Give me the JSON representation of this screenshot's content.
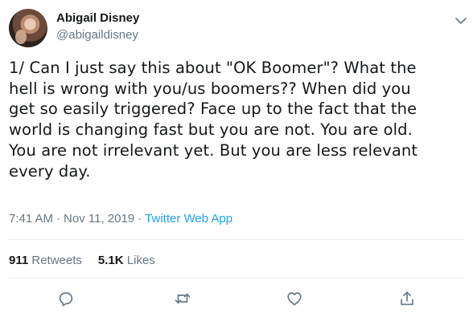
{
  "author": {
    "name": "Abigail Disney",
    "handle": "@abigaildisney",
    "avatar_icon": "user-avatar"
  },
  "tweet": {
    "text": "1/ Can I just say this about \"OK Boomer\"?  What the\nhell is wrong with you/us boomers??  When did you\nget so easily triggered?  Face up to the fact that the\nworld is changing fast but you are not.  You are old.\nYou are not irrelevant yet.  But you are less relevant\nevery day."
  },
  "meta": {
    "time": "7:41 AM",
    "separator": "·",
    "date": "Nov 11, 2019",
    "source": "Twitter Web App"
  },
  "stats": {
    "retweets_count": "911",
    "retweets_label": "Retweets",
    "likes_count": "5.1K",
    "likes_label": "Likes"
  },
  "actions": {
    "reply_icon": "reply-icon",
    "retweet_icon": "retweet-icon",
    "like_icon": "heart-icon",
    "share_icon": "share-icon"
  },
  "colors": {
    "text": "#14171a",
    "secondary": "#657786",
    "link": "#1da1f2",
    "divider": "#e6ecf0"
  }
}
